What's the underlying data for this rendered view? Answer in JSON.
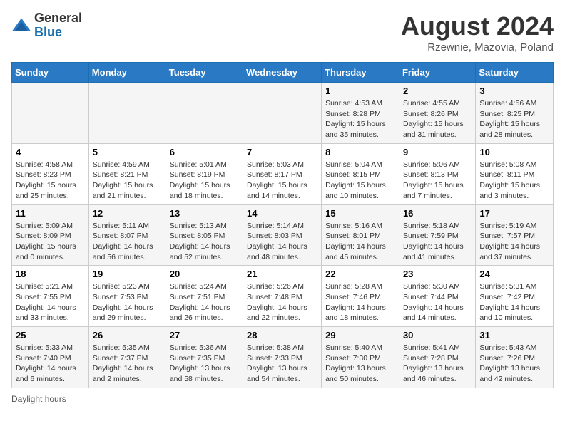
{
  "header": {
    "logo": {
      "general": "General",
      "blue": "Blue"
    },
    "title": "August 2024",
    "location": "Rzewnie, Mazovia, Poland"
  },
  "weekdays": [
    "Sunday",
    "Monday",
    "Tuesday",
    "Wednesday",
    "Thursday",
    "Friday",
    "Saturday"
  ],
  "weeks": [
    [
      {
        "day": "",
        "info": ""
      },
      {
        "day": "",
        "info": ""
      },
      {
        "day": "",
        "info": ""
      },
      {
        "day": "",
        "info": ""
      },
      {
        "day": "1",
        "info": "Sunrise: 4:53 AM\nSunset: 8:28 PM\nDaylight: 15 hours and 35 minutes."
      },
      {
        "day": "2",
        "info": "Sunrise: 4:55 AM\nSunset: 8:26 PM\nDaylight: 15 hours and 31 minutes."
      },
      {
        "day": "3",
        "info": "Sunrise: 4:56 AM\nSunset: 8:25 PM\nDaylight: 15 hours and 28 minutes."
      }
    ],
    [
      {
        "day": "4",
        "info": "Sunrise: 4:58 AM\nSunset: 8:23 PM\nDaylight: 15 hours and 25 minutes."
      },
      {
        "day": "5",
        "info": "Sunrise: 4:59 AM\nSunset: 8:21 PM\nDaylight: 15 hours and 21 minutes."
      },
      {
        "day": "6",
        "info": "Sunrise: 5:01 AM\nSunset: 8:19 PM\nDaylight: 15 hours and 18 minutes."
      },
      {
        "day": "7",
        "info": "Sunrise: 5:03 AM\nSunset: 8:17 PM\nDaylight: 15 hours and 14 minutes."
      },
      {
        "day": "8",
        "info": "Sunrise: 5:04 AM\nSunset: 8:15 PM\nDaylight: 15 hours and 10 minutes."
      },
      {
        "day": "9",
        "info": "Sunrise: 5:06 AM\nSunset: 8:13 PM\nDaylight: 15 hours and 7 minutes."
      },
      {
        "day": "10",
        "info": "Sunrise: 5:08 AM\nSunset: 8:11 PM\nDaylight: 15 hours and 3 minutes."
      }
    ],
    [
      {
        "day": "11",
        "info": "Sunrise: 5:09 AM\nSunset: 8:09 PM\nDaylight: 15 hours and 0 minutes."
      },
      {
        "day": "12",
        "info": "Sunrise: 5:11 AM\nSunset: 8:07 PM\nDaylight: 14 hours and 56 minutes."
      },
      {
        "day": "13",
        "info": "Sunrise: 5:13 AM\nSunset: 8:05 PM\nDaylight: 14 hours and 52 minutes."
      },
      {
        "day": "14",
        "info": "Sunrise: 5:14 AM\nSunset: 8:03 PM\nDaylight: 14 hours and 48 minutes."
      },
      {
        "day": "15",
        "info": "Sunrise: 5:16 AM\nSunset: 8:01 PM\nDaylight: 14 hours and 45 minutes."
      },
      {
        "day": "16",
        "info": "Sunrise: 5:18 AM\nSunset: 7:59 PM\nDaylight: 14 hours and 41 minutes."
      },
      {
        "day": "17",
        "info": "Sunrise: 5:19 AM\nSunset: 7:57 PM\nDaylight: 14 hours and 37 minutes."
      }
    ],
    [
      {
        "day": "18",
        "info": "Sunrise: 5:21 AM\nSunset: 7:55 PM\nDaylight: 14 hours and 33 minutes."
      },
      {
        "day": "19",
        "info": "Sunrise: 5:23 AM\nSunset: 7:53 PM\nDaylight: 14 hours and 29 minutes."
      },
      {
        "day": "20",
        "info": "Sunrise: 5:24 AM\nSunset: 7:51 PM\nDaylight: 14 hours and 26 minutes."
      },
      {
        "day": "21",
        "info": "Sunrise: 5:26 AM\nSunset: 7:48 PM\nDaylight: 14 hours and 22 minutes."
      },
      {
        "day": "22",
        "info": "Sunrise: 5:28 AM\nSunset: 7:46 PM\nDaylight: 14 hours and 18 minutes."
      },
      {
        "day": "23",
        "info": "Sunrise: 5:30 AM\nSunset: 7:44 PM\nDaylight: 14 hours and 14 minutes."
      },
      {
        "day": "24",
        "info": "Sunrise: 5:31 AM\nSunset: 7:42 PM\nDaylight: 14 hours and 10 minutes."
      }
    ],
    [
      {
        "day": "25",
        "info": "Sunrise: 5:33 AM\nSunset: 7:40 PM\nDaylight: 14 hours and 6 minutes."
      },
      {
        "day": "26",
        "info": "Sunrise: 5:35 AM\nSunset: 7:37 PM\nDaylight: 14 hours and 2 minutes."
      },
      {
        "day": "27",
        "info": "Sunrise: 5:36 AM\nSunset: 7:35 PM\nDaylight: 13 hours and 58 minutes."
      },
      {
        "day": "28",
        "info": "Sunrise: 5:38 AM\nSunset: 7:33 PM\nDaylight: 13 hours and 54 minutes."
      },
      {
        "day": "29",
        "info": "Sunrise: 5:40 AM\nSunset: 7:30 PM\nDaylight: 13 hours and 50 minutes."
      },
      {
        "day": "30",
        "info": "Sunrise: 5:41 AM\nSunset: 7:28 PM\nDaylight: 13 hours and 46 minutes."
      },
      {
        "day": "31",
        "info": "Sunrise: 5:43 AM\nSunset: 7:26 PM\nDaylight: 13 hours and 42 minutes."
      }
    ]
  ],
  "footer": {
    "note": "Daylight hours"
  }
}
